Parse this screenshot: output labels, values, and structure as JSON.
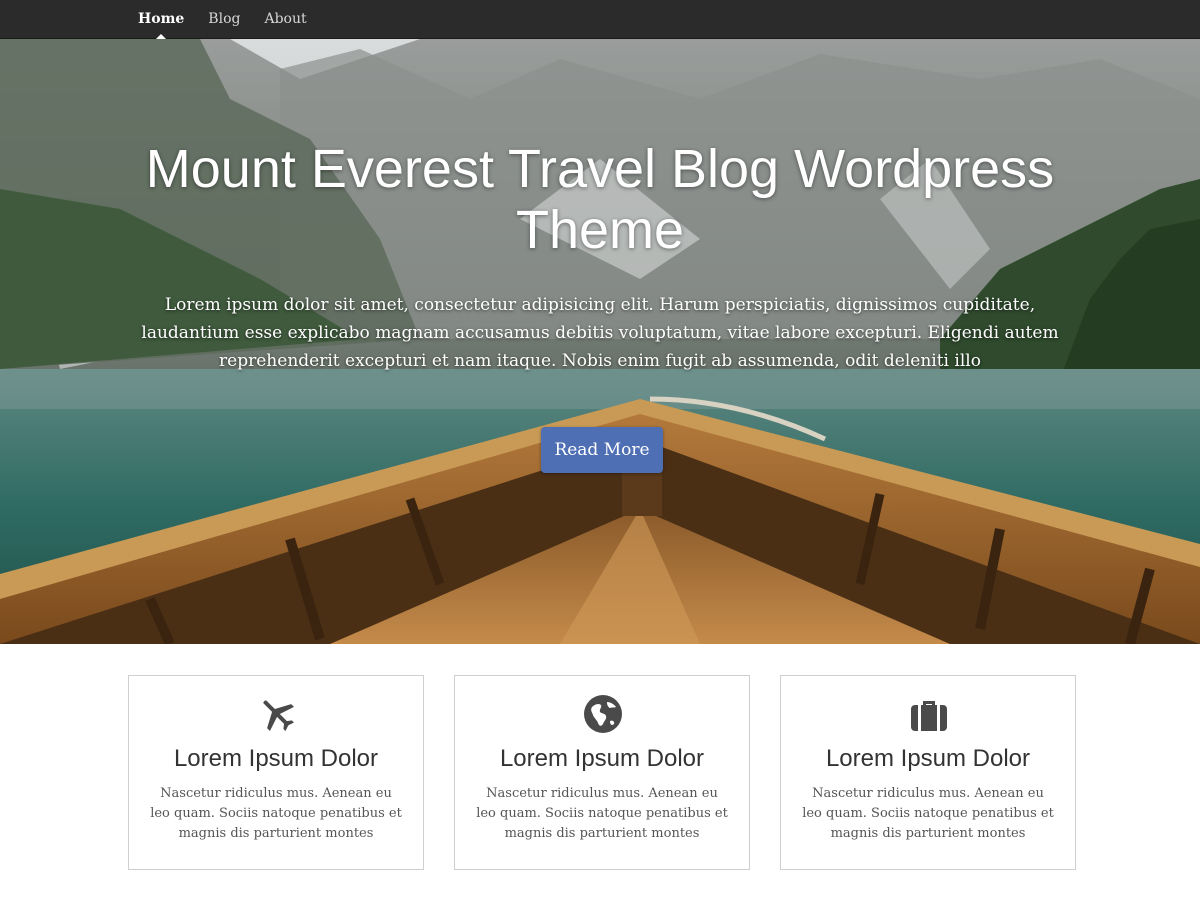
{
  "nav": {
    "items": [
      {
        "label": "Home",
        "active": true
      },
      {
        "label": "Blog",
        "active": false
      },
      {
        "label": "About",
        "active": false
      }
    ]
  },
  "hero": {
    "title": "Mount Everest Travel Blog Wordpress Theme",
    "text": "Lorem ipsum dolor sit amet, consectetur adipisicing elit. Harum perspiciatis, dignissimos cupiditate, laudantium esse explicabo magnam accusamus debitis voluptatum, vitae labore excepturi. Eligendi autem reprehenderit excepturi et nam itaque. Nobis enim fugit ab assumenda, odit deleniti illo",
    "button_label": "Read More"
  },
  "features": [
    {
      "icon": "airplane-icon",
      "title": "Lorem Ipsum Dolor",
      "text": "Nascetur ridiculus mus. Aenean eu leo quam. Sociis natoque penatibus et magnis dis parturient montes"
    },
    {
      "icon": "globe-icon",
      "title": "Lorem Ipsum Dolor",
      "text": "Nascetur ridiculus mus. Aenean eu leo quam. Sociis natoque penatibus et magnis dis parturient montes"
    },
    {
      "icon": "suitcase-icon",
      "title": "Lorem Ipsum Dolor",
      "text": "Nascetur ridiculus mus. Aenean eu leo quam. Sociis natoque penatibus et magnis dis parturient montes"
    }
  ],
  "colors": {
    "navbar": "#2b2b2b",
    "button": "#4f6fb5",
    "icon": "#4a4a4a"
  }
}
